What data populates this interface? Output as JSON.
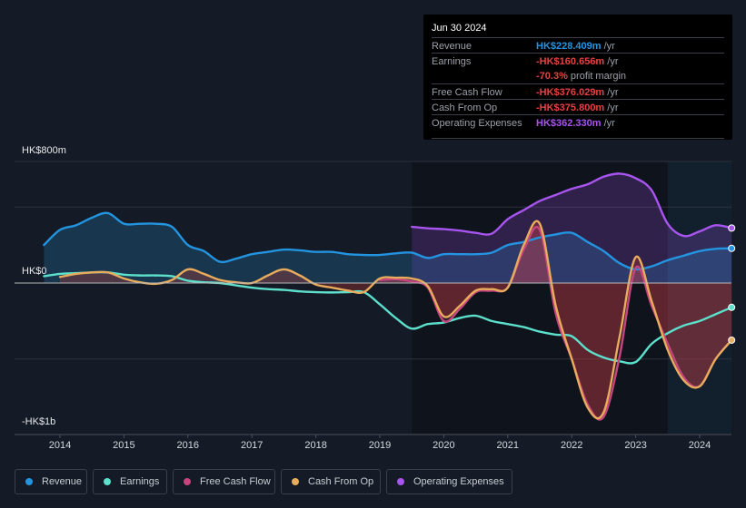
{
  "tooltip": {
    "date": "Jun 30 2024",
    "rows": [
      {
        "label": "Revenue",
        "value": "HK$228.409m",
        "suffix": " /yr",
        "color": "#2394df"
      },
      {
        "label": "Earnings",
        "value": "-HK$160.656m",
        "suffix": " /yr",
        "color": "#e64141"
      },
      {
        "label": "",
        "value": "-70.3%",
        "suffix": " profit margin",
        "color": "#e64141"
      },
      {
        "label": "Free Cash Flow",
        "value": "-HK$376.029m",
        "suffix": " /yr",
        "color": "#e64141"
      },
      {
        "label": "Cash From Op",
        "value": "-HK$375.800m",
        "suffix": " /yr",
        "color": "#e64141"
      },
      {
        "label": "Operating Expenses",
        "value": "HK$362.330m",
        "suffix": " /yr",
        "color": "#a855f0"
      }
    ]
  },
  "legend": [
    {
      "label": "Revenue",
      "color": "#2394df"
    },
    {
      "label": "Earnings",
      "color": "#5ce0cc"
    },
    {
      "label": "Free Cash Flow",
      "color": "#c5467e"
    },
    {
      "label": "Cash From Op",
      "color": "#e8ac5c"
    },
    {
      "label": "Operating Expenses",
      "color": "#a855f0"
    }
  ],
  "chart_data": {
    "type": "area",
    "title": "",
    "xlabel": "",
    "ylabel": "",
    "y_unit": "HK$ m",
    "ylim": [
      -1000,
      800
    ],
    "y_tick_labels": [
      {
        "value": 800,
        "label": "HK$800m"
      },
      {
        "value": 0,
        "label": "HK$0"
      },
      {
        "value": -1000,
        "label": "-HK$1b"
      }
    ],
    "x_tick_labels": [
      "2014",
      "2015",
      "2016",
      "2017",
      "2018",
      "2019",
      "2020",
      "2021",
      "2022",
      "2023",
      "2024"
    ],
    "xlim": [
      2013.0,
      2024.5
    ],
    "forecast_shade_from": 2023.5,
    "grid": true,
    "legend_position": "bottom",
    "series": [
      {
        "name": "Revenue",
        "color": "#2394df",
        "x": [
          2013.75,
          2014.0,
          2014.25,
          2014.5,
          2014.75,
          2015.0,
          2015.25,
          2015.5,
          2015.75,
          2016.0,
          2016.25,
          2016.5,
          2016.75,
          2017.0,
          2017.25,
          2017.5,
          2017.75,
          2018.0,
          2018.25,
          2018.5,
          2018.75,
          2019.0,
          2019.25,
          2019.5,
          2019.75,
          2020.0,
          2020.25,
          2020.5,
          2020.75,
          2021.0,
          2021.25,
          2021.5,
          2021.75,
          2022.0,
          2022.25,
          2022.5,
          2022.75,
          2023.0,
          2023.25,
          2023.5,
          2023.75,
          2024.0,
          2024.25,
          2024.5
        ],
        "values": [
          250,
          350,
          380,
          430,
          460,
          390,
          390,
          390,
          370,
          250,
          210,
          140,
          160,
          190,
          205,
          220,
          215,
          205,
          205,
          190,
          185,
          185,
          195,
          200,
          165,
          190,
          190,
          190,
          200,
          250,
          270,
          300,
          320,
          330,
          270,
          210,
          130,
          90,
          110,
          150,
          180,
          210,
          225,
          228
        ]
      },
      {
        "name": "Earnings",
        "color": "#5ce0cc",
        "x": [
          2013.75,
          2014.0,
          2014.25,
          2014.5,
          2014.75,
          2015.0,
          2015.25,
          2015.5,
          2015.75,
          2016.0,
          2016.25,
          2016.5,
          2016.75,
          2017.0,
          2017.25,
          2017.5,
          2017.75,
          2018.0,
          2018.25,
          2018.5,
          2018.75,
          2019.0,
          2019.25,
          2019.5,
          2019.75,
          2020.0,
          2020.25,
          2020.5,
          2020.75,
          2021.0,
          2021.25,
          2021.5,
          2021.75,
          2022.0,
          2022.25,
          2022.5,
          2022.75,
          2023.0,
          2023.25,
          2023.5,
          2023.75,
          2024.0,
          2024.25,
          2024.5
        ],
        "values": [
          45,
          60,
          65,
          70,
          70,
          55,
          50,
          50,
          45,
          15,
          5,
          0,
          -15,
          -30,
          -40,
          -45,
          -55,
          -60,
          -62,
          -60,
          -60,
          -140,
          -230,
          -300,
          -270,
          -260,
          -230,
          -215,
          -250,
          -270,
          -290,
          -320,
          -340,
          -350,
          -440,
          -490,
          -515,
          -520,
          -400,
          -330,
          -280,
          -250,
          -205,
          -160
        ]
      },
      {
        "name": "Free Cash Flow",
        "color": "#c5467e",
        "x": [
          2019.0,
          2019.25,
          2019.5,
          2019.75,
          2020.0,
          2020.25,
          2020.5,
          2020.75,
          2021.0,
          2021.25,
          2021.5,
          2021.75,
          2022.0,
          2022.25,
          2022.5,
          2022.75,
          2023.0,
          2023.25,
          2023.5,
          2023.75,
          2024.0,
          2024.25,
          2024.5
        ],
        "values": [
          20,
          25,
          10,
          -30,
          -250,
          -170,
          -60,
          -50,
          -30,
          220,
          350,
          -200,
          -500,
          -800,
          -880,
          -480,
          100,
          -150,
          -400,
          -620,
          -680,
          -500,
          -376
        ]
      },
      {
        "name": "Cash From Op",
        "color": "#e8ac5c",
        "x": [
          2014.0,
          2014.25,
          2014.5,
          2014.75,
          2015.0,
          2015.25,
          2015.5,
          2015.75,
          2016.0,
          2016.25,
          2016.5,
          2016.75,
          2017.0,
          2017.25,
          2017.5,
          2017.75,
          2018.0,
          2018.25,
          2018.5,
          2018.75,
          2019.0,
          2019.25,
          2019.5,
          2019.75,
          2020.0,
          2020.25,
          2020.5,
          2020.75,
          2021.0,
          2021.25,
          2021.5,
          2021.75,
          2022.0,
          2022.25,
          2022.5,
          2022.75,
          2023.0,
          2023.25,
          2023.5,
          2023.75,
          2024.0,
          2024.25,
          2024.5
        ],
        "values": [
          40,
          60,
          70,
          70,
          30,
          5,
          -5,
          20,
          90,
          60,
          20,
          5,
          0,
          50,
          90,
          50,
          -10,
          -30,
          -50,
          -60,
          30,
          35,
          30,
          -20,
          -220,
          -150,
          -50,
          -40,
          -30,
          250,
          390,
          -150,
          -500,
          -820,
          -850,
          -350,
          170,
          -120,
          -440,
          -640,
          -680,
          -500,
          -376
        ]
      },
      {
        "name": "Operating Expenses",
        "color": "#a855f0",
        "x": [
          2019.5,
          2019.75,
          2020.0,
          2020.25,
          2020.5,
          2020.75,
          2021.0,
          2021.25,
          2021.5,
          2021.75,
          2022.0,
          2022.25,
          2022.5,
          2022.75,
          2023.0,
          2023.25,
          2023.5,
          2023.75,
          2024.0,
          2024.25,
          2024.5
        ],
        "values": [
          370,
          360,
          355,
          345,
          330,
          325,
          420,
          480,
          540,
          580,
          620,
          650,
          700,
          720,
          690,
          610,
          390,
          310,
          340,
          380,
          362
        ]
      }
    ]
  }
}
